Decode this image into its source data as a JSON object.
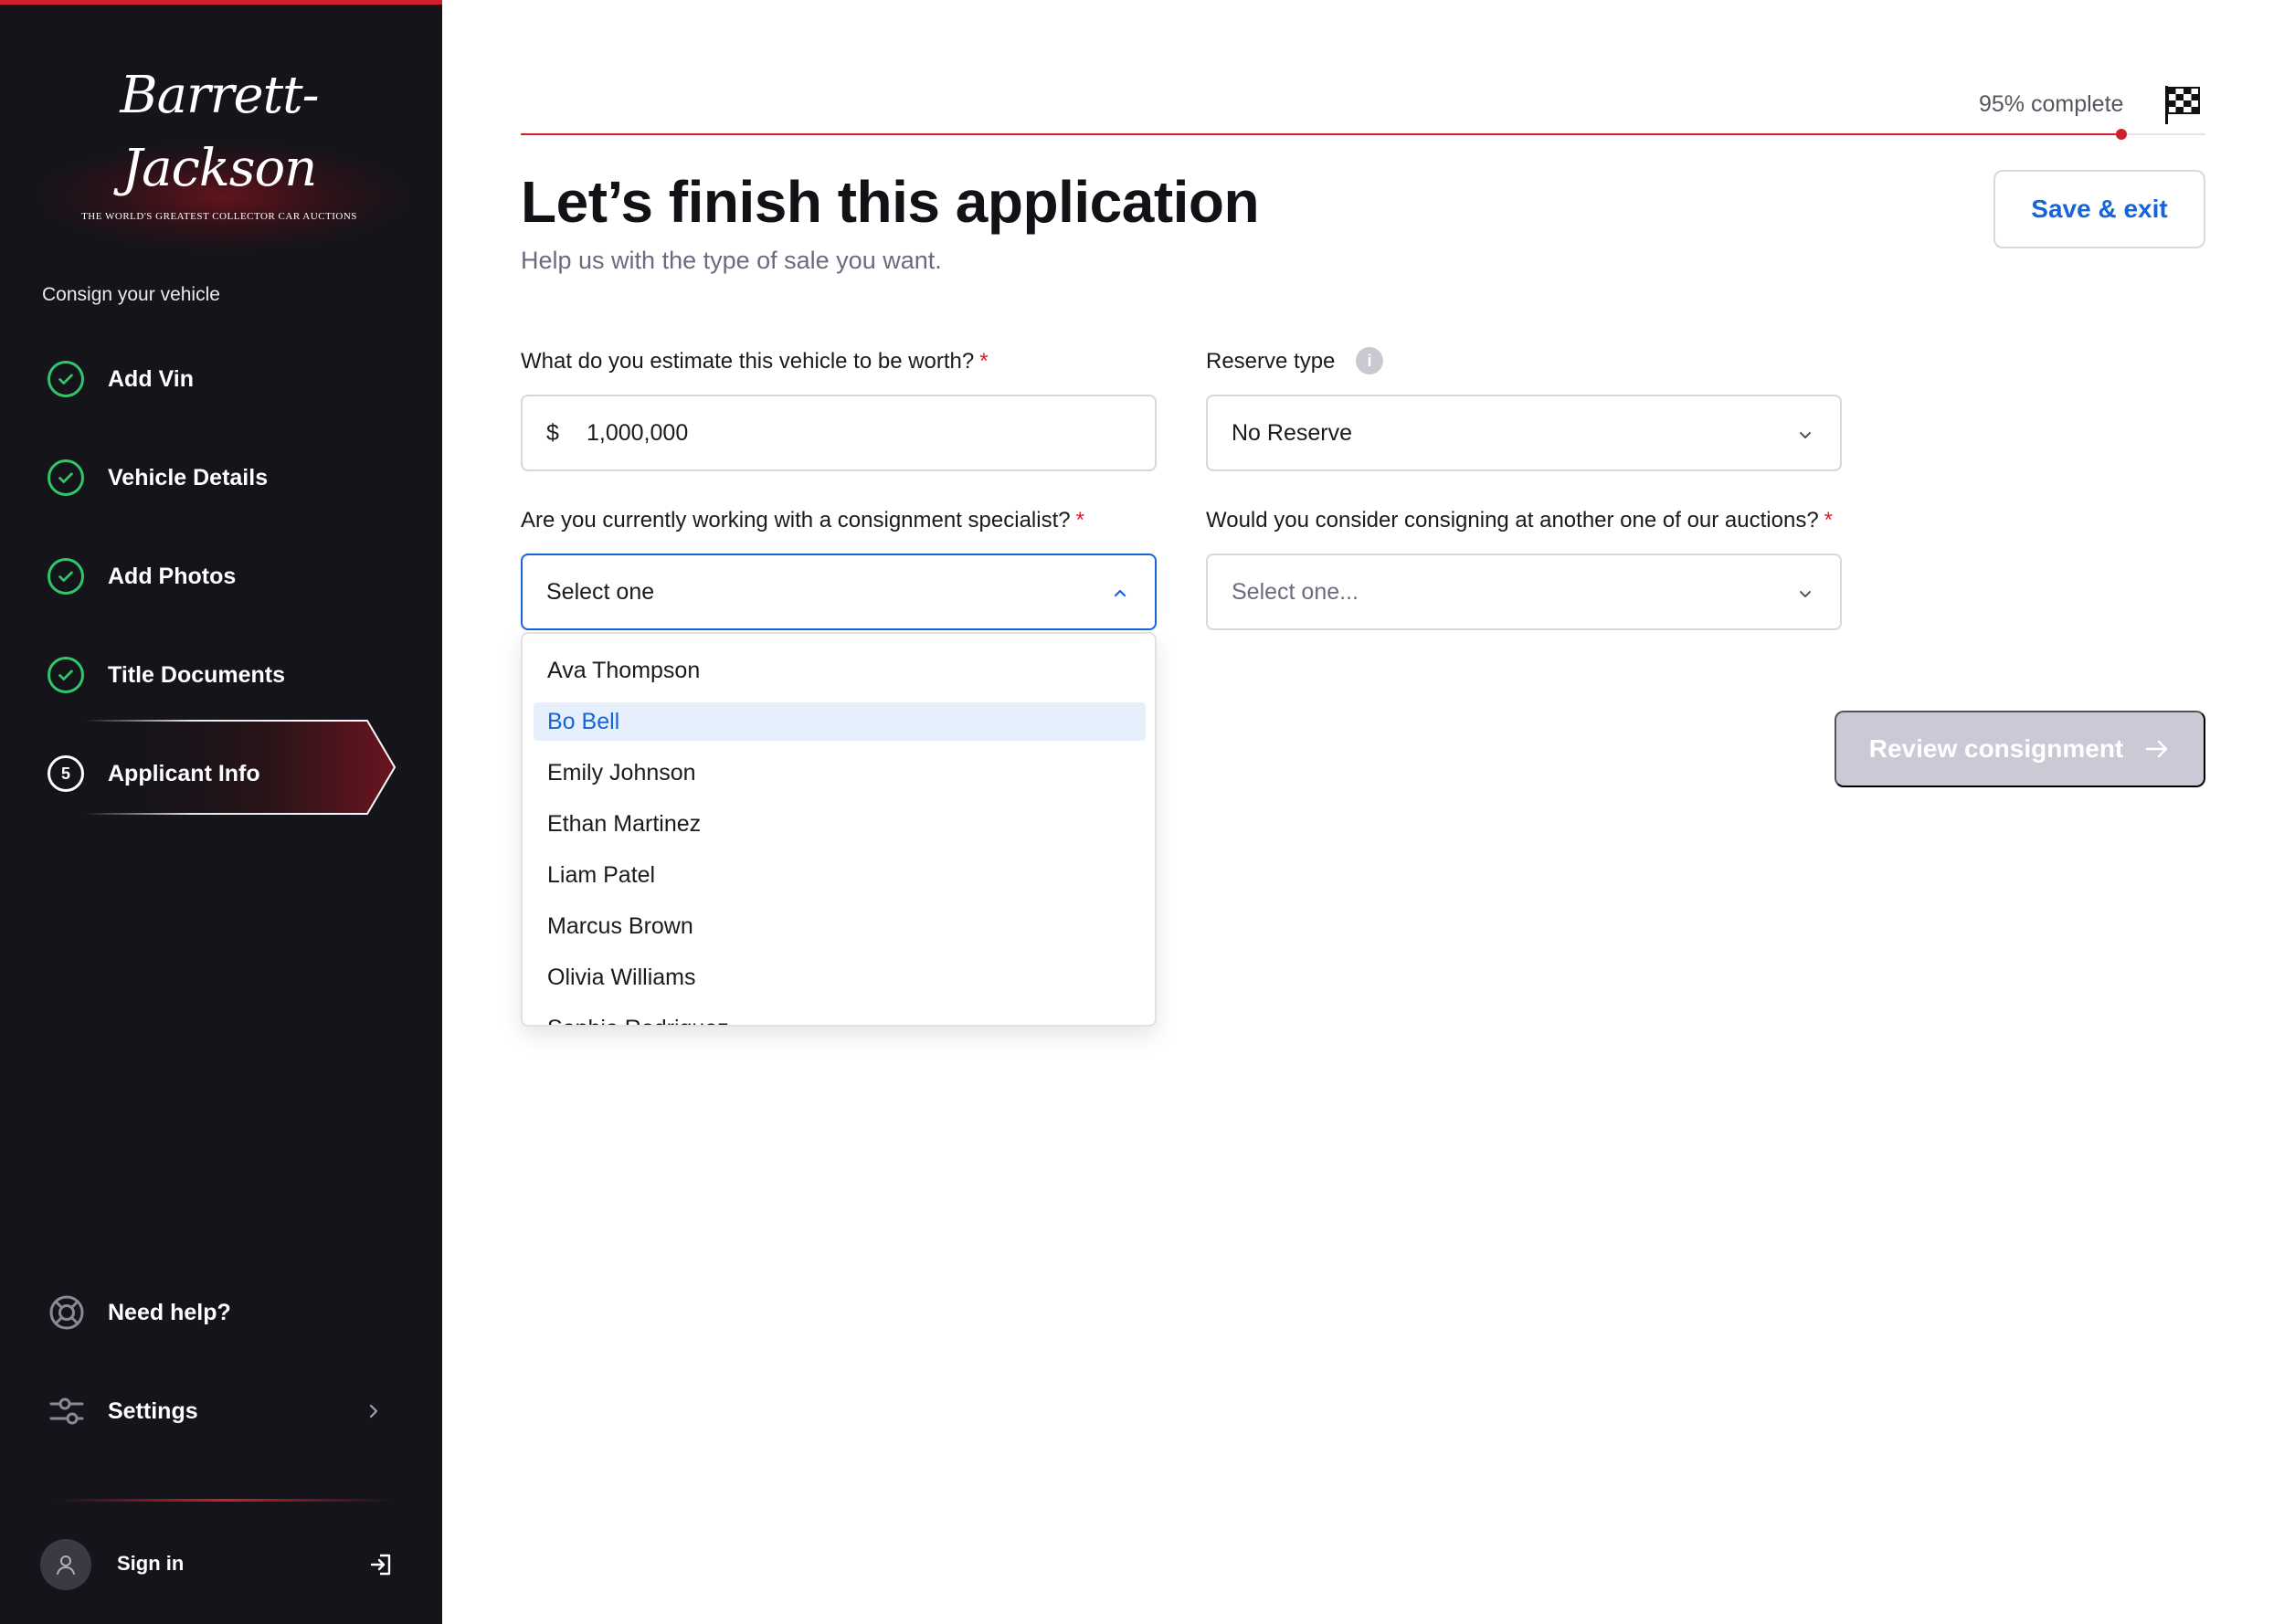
{
  "brand": {
    "logo_text": "Barrett-Jackson",
    "tagline": "The World's Greatest Collector Car Auctions"
  },
  "sidebar": {
    "section_label": "Consign your vehicle",
    "steps": [
      {
        "label": "Add Vin",
        "status": "complete"
      },
      {
        "label": "Vehicle Details",
        "status": "complete"
      },
      {
        "label": "Add Photos",
        "status": "complete"
      },
      {
        "label": "Title Documents",
        "status": "complete"
      },
      {
        "label": "Applicant Info",
        "status": "active",
        "number": "5"
      }
    ],
    "help_label": "Need help?",
    "settings_label": "Settings",
    "signin_label": "Sign in"
  },
  "progress": {
    "text": "95% complete",
    "value": 0.95
  },
  "header": {
    "title": "Let’s finish this application",
    "subtitle": "Help us with the type of sale you want.",
    "save_label": "Save & exit"
  },
  "form": {
    "worth": {
      "label": "What do you estimate this vehicle to be worth?",
      "prefix": "$",
      "value": "1,000,000"
    },
    "reserve": {
      "label": "Reserve type",
      "value": "No Reserve"
    },
    "specialist": {
      "label": "Are you currently working with a consignment specialist?",
      "value": "Select one",
      "options": [
        "Ava Thompson",
        "Bo Bell",
        "Emily Johnson",
        "Ethan Martinez",
        "Liam Patel",
        "Marcus Brown",
        "Olivia Williams",
        "Sophia Rodriguez"
      ],
      "highlighted": "Bo Bell"
    },
    "other_auction": {
      "label": "Would you consider consigning at another one of our auctions?",
      "placeholder": "Select one..."
    },
    "required_mark": "*",
    "info_glyph": "i"
  },
  "actions": {
    "review_label": "Review consignment"
  },
  "colors": {
    "accent_red": "#d11f2b",
    "link_blue": "#1565d8",
    "check_green": "#2fc76a",
    "sidebar_bg": "#14141a",
    "disabled_btn": "#c9cad6"
  }
}
